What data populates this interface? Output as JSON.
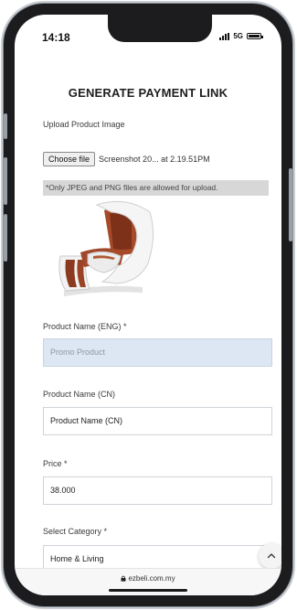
{
  "status": {
    "time": "14:18",
    "network": "5G"
  },
  "page": {
    "title": "GENERATE PAYMENT LINK"
  },
  "upload": {
    "label": "Upload Product Image",
    "button_label": "Choose file",
    "file_name": "Screenshot 20... at 2.19.51PM",
    "note": "*Only JPEG and PNG files are allowed for upload."
  },
  "fields": {
    "name_eng": {
      "label": "Product Name (ENG) *",
      "value": "Promo Product"
    },
    "name_cn": {
      "label": "Product Name (CN)",
      "value": "Product Name (CN)"
    },
    "price": {
      "label": "Price *",
      "value": "38.000"
    },
    "category": {
      "label": "Select Category *",
      "value": "Home & Living"
    }
  },
  "browser": {
    "url": "ezbeli.com.my"
  },
  "icons": {
    "product_image": "massage-chair-image",
    "scroll_top": "chevron-up-icon",
    "lock": "lock-icon"
  }
}
